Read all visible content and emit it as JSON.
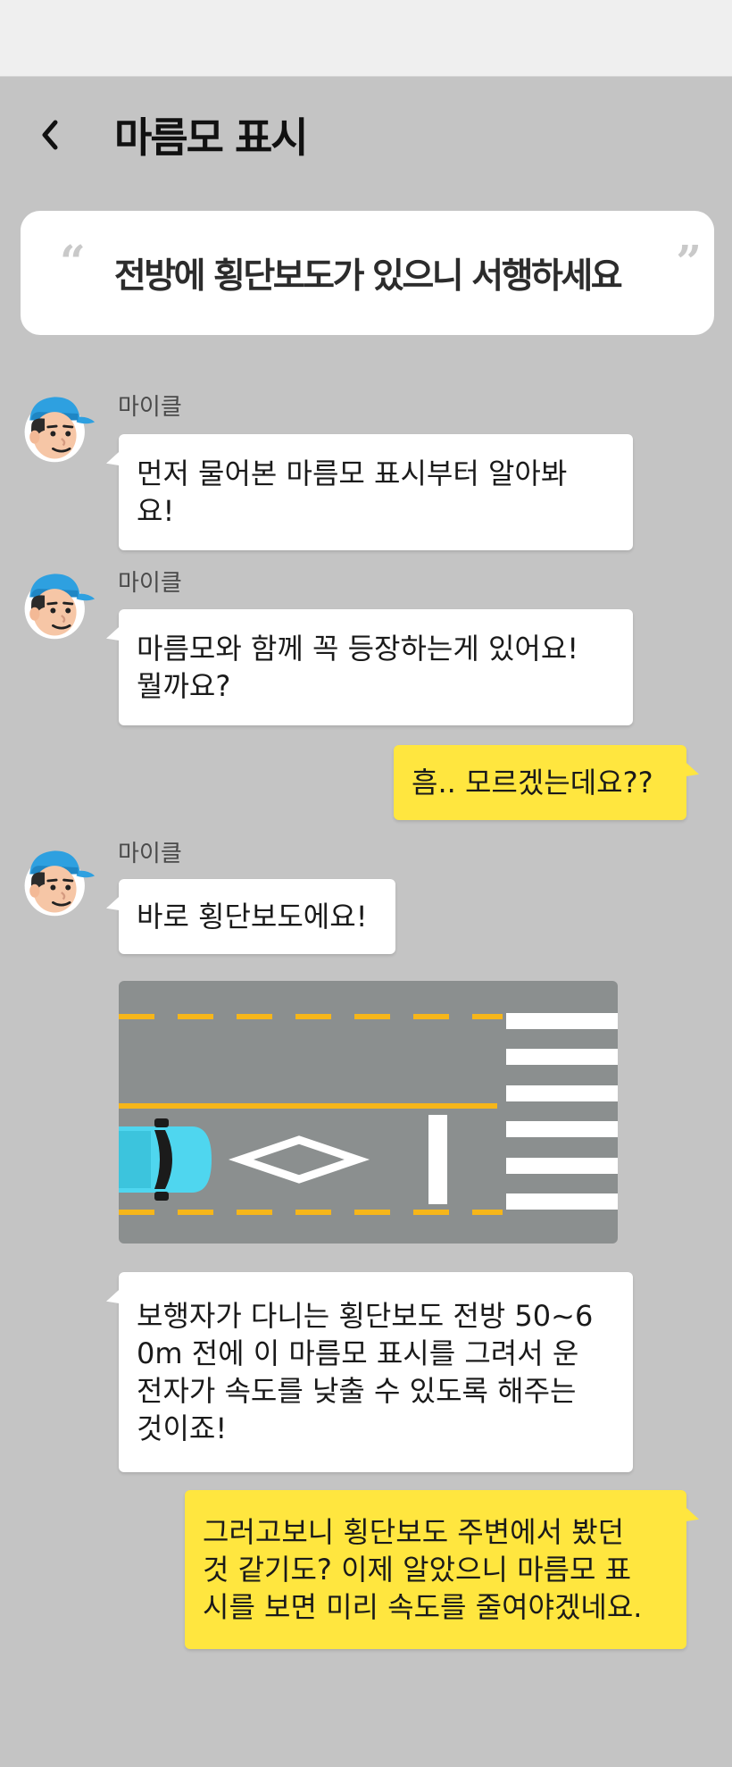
{
  "header": {
    "title": "마름모 표시"
  },
  "quote": {
    "open": "“",
    "text": "전방에 횡단보도가 있으니 서행하세요",
    "close": "”"
  },
  "messages": [
    {
      "sender": "마이클",
      "text": "먼저 물어본 마름모 표시부터 알아봐\n요!"
    },
    {
      "sender": "마이클",
      "text": "마름모와 함께 꼭 등장하는게 있어요!\n뭘까요?"
    },
    {
      "text": "흠.. 모르겠는데요??"
    },
    {
      "sender": "마이클",
      "text": "바로 횡단보도에요!"
    },
    {
      "text": "보행자가 다니는 횡단보도 전방 50~6\n0m 전에 이 마름모 표시를 그려서 운\n전자가 속도를 낮출 수 있도록 해주는\n것이죠!"
    },
    {
      "text": "그러고보니 횡단보도 주변에서 봤던\n것 같기도? 이제 알았으니 마름모 표\n시를 보면 미리 속도를 줄여야겠네요."
    }
  ],
  "colors": {
    "background": "#c4c4c4",
    "my_bubble": "#ffe63f",
    "other_bubble": "#ffffff",
    "road": "#8b8f8f",
    "lane_yellow": "#f6b61a",
    "car": "#4fd6ef",
    "cap": "#2ea0e0"
  },
  "icons": [
    "back-chevron-icon",
    "avatar-michael-icon",
    "crosswalk-diagram"
  ]
}
